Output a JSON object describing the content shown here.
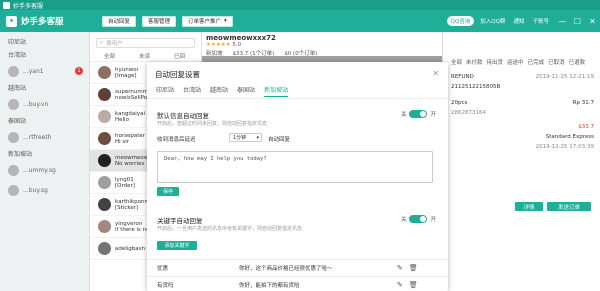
{
  "window": {
    "title": "妙手多客服"
  },
  "topbar": {
    "brand": "妙手多客服",
    "buttons": [
      "自动回复",
      "客服管理",
      "订单客户推广"
    ],
    "pill": "QQ咨询",
    "join_text": "加入QQ群",
    "notify_text": "通知",
    "user_text": "子账号"
  },
  "sidebar": {
    "sections": [
      "印尼站",
      "台湾站",
      "越南站",
      "泰国站",
      "新加坡站"
    ],
    "shops": [
      {
        "name": "...yan1",
        "badge": "1"
      },
      {
        "name": "...buy.vn"
      },
      {
        "name": "...rtfreeth"
      },
      {
        "name": "...ummy.sg"
      },
      {
        "name": "...buy.sg"
      }
    ]
  },
  "chatlist": {
    "search_placeholder": "搜用户",
    "filters": [
      "全部",
      "未读",
      "已回"
    ],
    "items": [
      {
        "name": "hyunwoi",
        "msg": "[Image]"
      },
      {
        "name": "supernumm",
        "msg": "nowlsSellPo"
      },
      {
        "name": "kangdaiyai",
        "msg": "Hello"
      },
      {
        "name": "horsepater",
        "msg": "Hi sir"
      },
      {
        "name": "meowmeow",
        "msg": "No worries"
      },
      {
        "name": "lyng01",
        "msg": "[Order]"
      },
      {
        "name": "karthikponm",
        "msg": "[Sticker]"
      },
      {
        "name": "yingveron",
        "msg": "if there is no"
      },
      {
        "name": "adeligbash",
        "msg": ""
      }
    ]
  },
  "chat_header": {
    "username": "meowmeowxxx72",
    "rating": "5.0",
    "location": "新加坡",
    "spent": "$33.7 (1个订单)",
    "pending": "$0 (0个订单)"
  },
  "right_panel": {
    "tabs": [
      "全部",
      "未付款",
      "待出货",
      "运送中",
      "已完成",
      "已取消",
      "已退款"
    ],
    "refund": "REFUND",
    "order_id": "2112512215805B",
    "order_date": "2019-11-25 12:21:19",
    "item_label": "20pcs",
    "item_price": "Rp 31.7",
    "item_id": "2862873164",
    "total": "$33.7",
    "shipping": "Standard Express",
    "shipping_date": "2019-12-25 17:03:39",
    "btn_detail": "详情",
    "btn_send": "发送订单"
  },
  "dialog": {
    "title": "自动回复设置",
    "tabs": [
      "印尼站",
      "台湾站",
      "越南站",
      "泰国站",
      "新加坡站"
    ],
    "active_tab": "新加坡站",
    "default_section": {
      "title": "默认信息自动回复",
      "desc": "开启后，若超过时间未回复，则自动回复指定讯息",
      "toggle_off": "关",
      "toggle_on": "开",
      "row_prefix": "收到消息后延迟",
      "delay_value": "1分钟",
      "row_suffix": "自动回复",
      "reply_text": "Dear, how may I help you today?",
      "save_label": "保存"
    },
    "keyword_section": {
      "title": "关键字自动回复",
      "desc": "开启后，一旦用户发送的讯息中含有关键字，则自动回复指定讯息",
      "toggle_off": "关",
      "toggle_on": "开",
      "add_label": "添加关键字",
      "rows": [
        {
          "keyword": "优惠",
          "reply": "你好，这个商品价格已经很优惠了哈～"
        },
        {
          "keyword": "有货吗",
          "reply": "你好，能拍下的都有货哈"
        }
      ]
    }
  }
}
